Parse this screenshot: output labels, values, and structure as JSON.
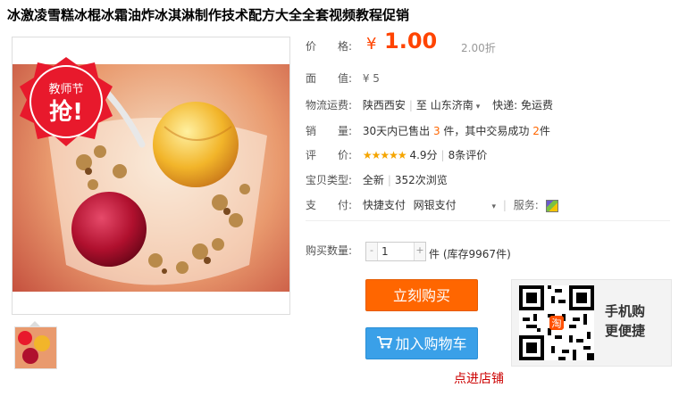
{
  "title": "冰激凌雪糕冰棍冰霜油炸冰淇淋制作技术配方大全全套视频教程促销",
  "image": {
    "badge_top": "教师节",
    "badge_bottom": "抢!"
  },
  "price": {
    "label": "价　　格:",
    "symbol": "¥",
    "value": "1.00",
    "discount": "2.00折"
  },
  "face_value": {
    "label": "面　　值:",
    "value": "¥ 5"
  },
  "logistics": {
    "label": "物流运费:",
    "from": "陕西西安",
    "to_prefix": "至",
    "to": "山东济南",
    "shipping": "快递: 免运费"
  },
  "sales": {
    "label": "销　　量:",
    "prefix": "30天内已售出",
    "sold": "3",
    "mid": "件，其中交易成功",
    "success": "2",
    "suffix": "件"
  },
  "rating": {
    "label": "评　　价:",
    "stars": "★★★★★",
    "score": "4.9分",
    "reviews": "8条评价"
  },
  "item_type": {
    "label": "宝贝类型:",
    "condition": "全新",
    "views": "352次浏览"
  },
  "payment": {
    "label": "支　　付:",
    "method1": "快捷支付",
    "method2": "网银支付",
    "service_label": "服务:"
  },
  "quantity": {
    "label": "购买数量:",
    "value": "1",
    "minus": "-",
    "plus": "+",
    "unit": "件",
    "stock": "(库存9967件)"
  },
  "buttons": {
    "buy_now": "立刻购买",
    "add_to_cart": "加入购物车"
  },
  "mobile": {
    "line1": "手机购",
    "line2": "更便捷",
    "logo": "淘"
  },
  "shop_link": "点进店铺",
  "colors": {
    "accent_orange": "#ff6600",
    "price_red": "#ff4400",
    "cart_blue": "#3aa0e8",
    "link_red": "#cc0000"
  }
}
